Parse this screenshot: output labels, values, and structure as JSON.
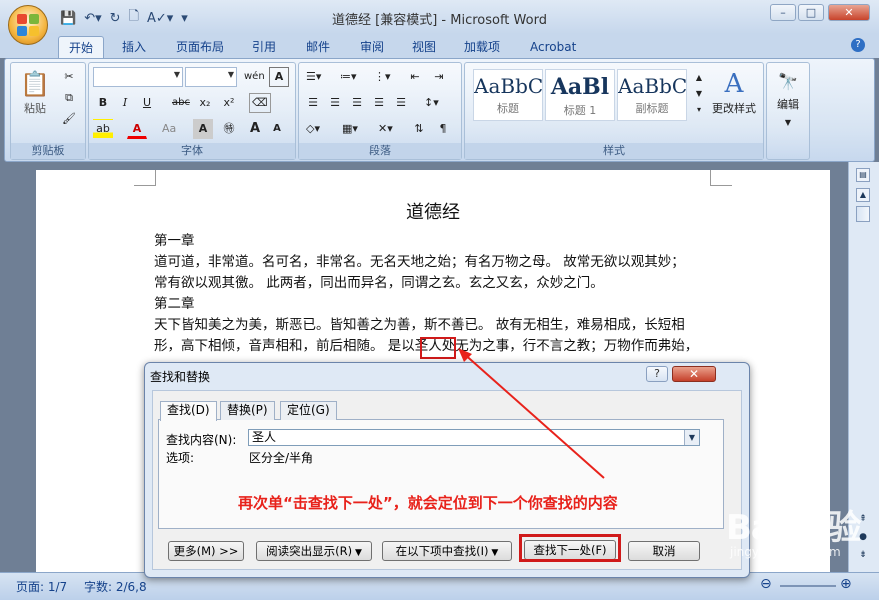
{
  "window": {
    "title": "道德经 [兼容模式] - Microsoft Word",
    "minimize": "–",
    "restore": "□",
    "close": "✕",
    "help": "?"
  },
  "tabs": [
    "开始",
    "插入",
    "页面布局",
    "引用",
    "邮件",
    "审阅",
    "视图",
    "加载项",
    "Acrobat"
  ],
  "ribbon": {
    "clipboard": {
      "label": "剪贴板",
      "paste": "粘贴"
    },
    "font": {
      "label": "字体",
      "bold": "B",
      "italic": "I",
      "underline": "U",
      "strike": "abc",
      "subscript": "x₂",
      "superscript": "x²",
      "grow": "A",
      "shrink": "A",
      "font_color": "A",
      "aa": "Aa",
      "char_border": "A",
      "phonetic": "wén"
    },
    "paragraph": {
      "label": "段落"
    },
    "styles": {
      "label": "样式",
      "items": [
        {
          "sample": "AaBbC",
          "name": "标题"
        },
        {
          "sample": "AaBl",
          "name": "标题 1"
        },
        {
          "sample": "AaBbC",
          "name": "副标题"
        }
      ],
      "change_styles": "更改样式"
    },
    "editing": {
      "label": "编辑"
    }
  },
  "document": {
    "title": "道德经",
    "lines": [
      "第一章",
      "道可道，非常道。名可名，非常名。无名天地之始；有名万物之母。 故常无欲以观其妙；",
      "常有欲以观其徼。 此两者，同出而异名，同谓之玄。玄之又玄，众妙之门。",
      "第二章",
      "天下皆知美之为美，斯恶已。皆知善之为善，斯不善已。 故有无相生，难易相成，长短相",
      "形，高下相倾，音声相和，前后相随。 是以圣人处无为之事，行不言之教；万物作而弗始，"
    ],
    "highlighted": "圣人"
  },
  "status": {
    "page": "页面: 1/7",
    "words": "字数: 2/6,8"
  },
  "dialog": {
    "title": "查找和替换",
    "tabs": [
      "查找(D)",
      "替换(P)",
      "定位(G)"
    ],
    "find_label": "查找内容(N):",
    "find_value": "圣人",
    "options_label": "选项:",
    "options_value": "区分全/半角",
    "buttons": {
      "more": "更多(M) >>",
      "reading_highlight": "阅读突出显示(R)",
      "find_in": "在以下项中查找(I)",
      "find_next": "查找下一处(F)",
      "cancel": "取消"
    }
  },
  "annotation": "再次单“击查找下一处”，就会定位到下一个你查找的内容",
  "watermark": {
    "logo": "Bai 经验",
    "url": "jingyan.baidu.com"
  },
  "colors": {
    "accent_red": "#d01a1a",
    "ribbon_blue": "#c6d7ec",
    "annotation": "#e8221b"
  }
}
